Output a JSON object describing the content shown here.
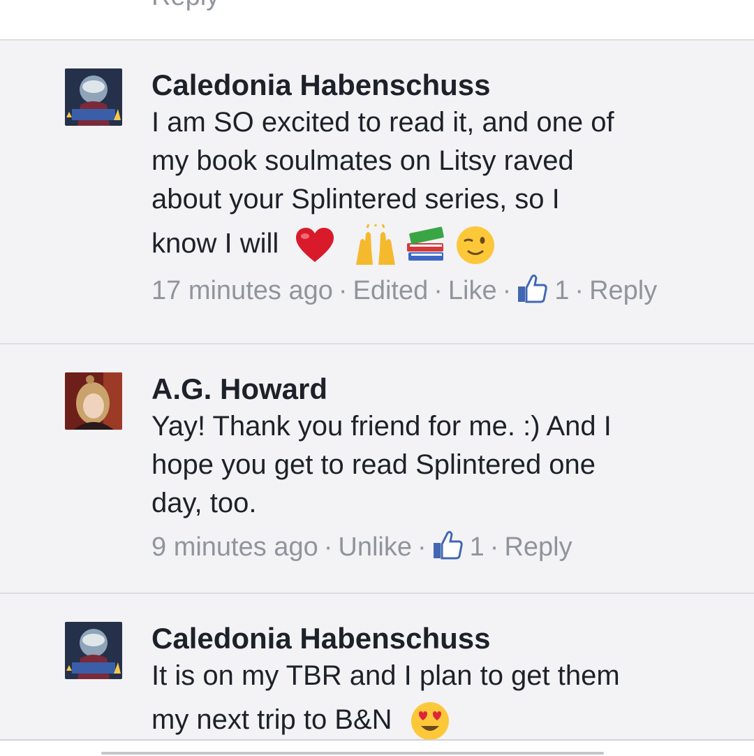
{
  "top": {
    "cut_label": "Reply"
  },
  "comments": [
    {
      "author": "Caledonia Habenschuss",
      "text_lines": [
        "I am SO excited to read it, and one of",
        "my book soulmates on Litsy raved",
        "about your Splintered series, so I",
        "know I will"
      ],
      "emojis": [
        "red-heart-icon",
        "raised-hands-icon",
        "books-icon",
        "winking-face-icon"
      ],
      "meta": {
        "time": "17 minutes ago",
        "edited": "Edited",
        "like": "Like",
        "like_count": "1",
        "reply": "Reply"
      }
    },
    {
      "author": "A.G. Howard",
      "text_lines": [
        "Yay! Thank you friend for me. :) And I",
        "hope you get to read Splintered one",
        "day, too."
      ],
      "meta": {
        "time": "9 minutes ago",
        "like": "Unlike",
        "like_count": "1",
        "reply": "Reply"
      }
    },
    {
      "author": "Caledonia Habenschuss",
      "text_lines": [
        "It is on my TBR and I plan to get them",
        "my next trip to B&N"
      ],
      "emojis": [
        "heart-eyes-face-icon"
      ]
    }
  ],
  "colors": {
    "meta_gray": "#90949c",
    "like_blue": "#4267b2",
    "background": "#f3f3f5"
  }
}
